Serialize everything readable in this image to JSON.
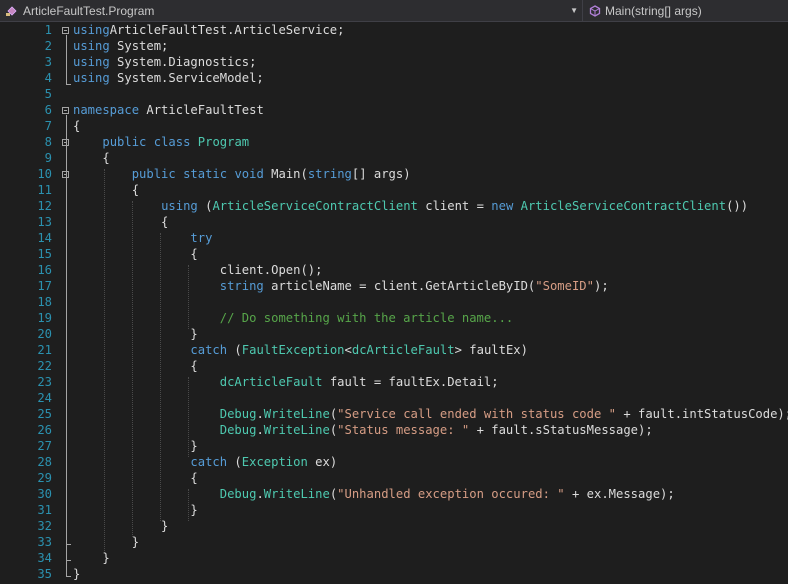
{
  "navbar": {
    "left_label": "ArticleFaultTest.Program",
    "right_label": "Main(string[] args)",
    "dropdown_icon": "chevron-down-icon"
  },
  "editor": {
    "lines": [
      {
        "n": "1",
        "tokens": [
          [
            "kw",
            "using"
          ],
          [
            "",
            "ArticleFaultTest.ArticleService;"
          ]
        ]
      },
      {
        "n": "2",
        "tokens": [
          [
            "kw",
            "using"
          ],
          [
            "",
            " System;"
          ]
        ]
      },
      {
        "n": "3",
        "tokens": [
          [
            "kw",
            "using"
          ],
          [
            "",
            " System.Diagnostics;"
          ]
        ]
      },
      {
        "n": "4",
        "tokens": [
          [
            "kw",
            "using"
          ],
          [
            "",
            " System.ServiceModel;"
          ]
        ]
      },
      {
        "n": "5",
        "tokens": []
      },
      {
        "n": "6",
        "tokens": [
          [
            "kw",
            "namespace"
          ],
          [
            "",
            " ArticleFaultTest"
          ]
        ]
      },
      {
        "n": "7",
        "tokens": [
          [
            "",
            "{"
          ]
        ]
      },
      {
        "n": "8",
        "tokens": [
          [
            "",
            "    "
          ],
          [
            "kw",
            "public"
          ],
          [
            "",
            " "
          ],
          [
            "kw",
            "class"
          ],
          [
            "",
            " "
          ],
          [
            "ty",
            "Program"
          ]
        ]
      },
      {
        "n": "9",
        "tokens": [
          [
            "",
            "    {"
          ]
        ]
      },
      {
        "n": "10",
        "tokens": [
          [
            "",
            "        "
          ],
          [
            "kw",
            "public"
          ],
          [
            "",
            " "
          ],
          [
            "kw",
            "static"
          ],
          [
            "",
            " "
          ],
          [
            "kw",
            "void"
          ],
          [
            "",
            " Main("
          ],
          [
            "kw",
            "string"
          ],
          [
            "",
            "[] args)"
          ]
        ]
      },
      {
        "n": "11",
        "tokens": [
          [
            "",
            "        {"
          ]
        ]
      },
      {
        "n": "12",
        "tokens": [
          [
            "",
            "            "
          ],
          [
            "kw",
            "using"
          ],
          [
            "",
            " ("
          ],
          [
            "ty",
            "ArticleServiceContractClient"
          ],
          [
            "",
            " client = "
          ],
          [
            "kw",
            "new"
          ],
          [
            "",
            " "
          ],
          [
            "ty",
            "ArticleServiceContractClient"
          ],
          [
            "",
            "())"
          ]
        ]
      },
      {
        "n": "13",
        "tokens": [
          [
            "",
            "            {"
          ]
        ]
      },
      {
        "n": "14",
        "tokens": [
          [
            "",
            "                "
          ],
          [
            "kw",
            "try"
          ]
        ]
      },
      {
        "n": "15",
        "tokens": [
          [
            "",
            "                {"
          ]
        ]
      },
      {
        "n": "16",
        "tokens": [
          [
            "",
            "                    client.Open();"
          ]
        ]
      },
      {
        "n": "17",
        "tokens": [
          [
            "",
            "                    "
          ],
          [
            "kw",
            "string"
          ],
          [
            "",
            " articleName = client.GetArticleByID("
          ],
          [
            "str",
            "\"SomeID\""
          ],
          [
            "",
            ");"
          ]
        ]
      },
      {
        "n": "18",
        "tokens": []
      },
      {
        "n": "19",
        "tokens": [
          [
            "",
            "                    "
          ],
          [
            "cm",
            "// Do something with the article name..."
          ]
        ]
      },
      {
        "n": "20",
        "tokens": [
          [
            "",
            "                }"
          ]
        ]
      },
      {
        "n": "21",
        "tokens": [
          [
            "",
            "                "
          ],
          [
            "kw",
            "catch"
          ],
          [
            "",
            " ("
          ],
          [
            "ty",
            "FaultException"
          ],
          [
            "",
            "<"
          ],
          [
            "ty",
            "dcArticleFault"
          ],
          [
            "",
            "> faultEx)"
          ]
        ]
      },
      {
        "n": "22",
        "tokens": [
          [
            "",
            "                {"
          ]
        ]
      },
      {
        "n": "23",
        "tokens": [
          [
            "",
            "                    "
          ],
          [
            "ty",
            "dcArticleFault"
          ],
          [
            "",
            " fault = faultEx.Detail;"
          ]
        ]
      },
      {
        "n": "24",
        "tokens": []
      },
      {
        "n": "25",
        "tokens": [
          [
            "",
            "                    "
          ],
          [
            "ty",
            "Debug"
          ],
          [
            "",
            "."
          ],
          [
            "ty",
            "WriteLine"
          ],
          [
            "",
            "("
          ],
          [
            "str",
            "\"Service call ended with status code \""
          ],
          [
            "",
            " + fault.intStatusCode);"
          ]
        ]
      },
      {
        "n": "26",
        "tokens": [
          [
            "",
            "                    "
          ],
          [
            "ty",
            "Debug"
          ],
          [
            "",
            "."
          ],
          [
            "ty",
            "WriteLine"
          ],
          [
            "",
            "("
          ],
          [
            "str",
            "\"Status message: \""
          ],
          [
            "",
            " + fault.sStatusMessage);"
          ]
        ]
      },
      {
        "n": "27",
        "tokens": [
          [
            "",
            "                }"
          ]
        ]
      },
      {
        "n": "28",
        "tokens": [
          [
            "",
            "                "
          ],
          [
            "kw",
            "catch"
          ],
          [
            "",
            " ("
          ],
          [
            "ty",
            "Exception"
          ],
          [
            "",
            " ex)"
          ]
        ]
      },
      {
        "n": "29",
        "tokens": [
          [
            "",
            "                {"
          ]
        ]
      },
      {
        "n": "30",
        "tokens": [
          [
            "",
            "                    "
          ],
          [
            "ty",
            "Debug"
          ],
          [
            "",
            "."
          ],
          [
            "ty",
            "WriteLine"
          ],
          [
            "",
            "("
          ],
          [
            "str",
            "\"Unhandled exception occured: \""
          ],
          [
            "",
            " + ex.Message);"
          ]
        ]
      },
      {
        "n": "31",
        "tokens": [
          [
            "",
            "                }"
          ]
        ]
      },
      {
        "n": "32",
        "tokens": [
          [
            "",
            "            }"
          ]
        ]
      },
      {
        "n": "33",
        "tokens": [
          [
            "",
            "        }"
          ]
        ]
      },
      {
        "n": "34",
        "tokens": [
          [
            "",
            "    }"
          ]
        ]
      },
      {
        "n": "35",
        "tokens": [
          [
            "",
            "}"
          ]
        ]
      }
    ]
  },
  "colors": {
    "background": "#1e1e1e",
    "keyword": "#569cd6",
    "type": "#4ec9b0",
    "string": "#d69d85",
    "comment": "#57a64a",
    "line_number": "#2b91af"
  }
}
